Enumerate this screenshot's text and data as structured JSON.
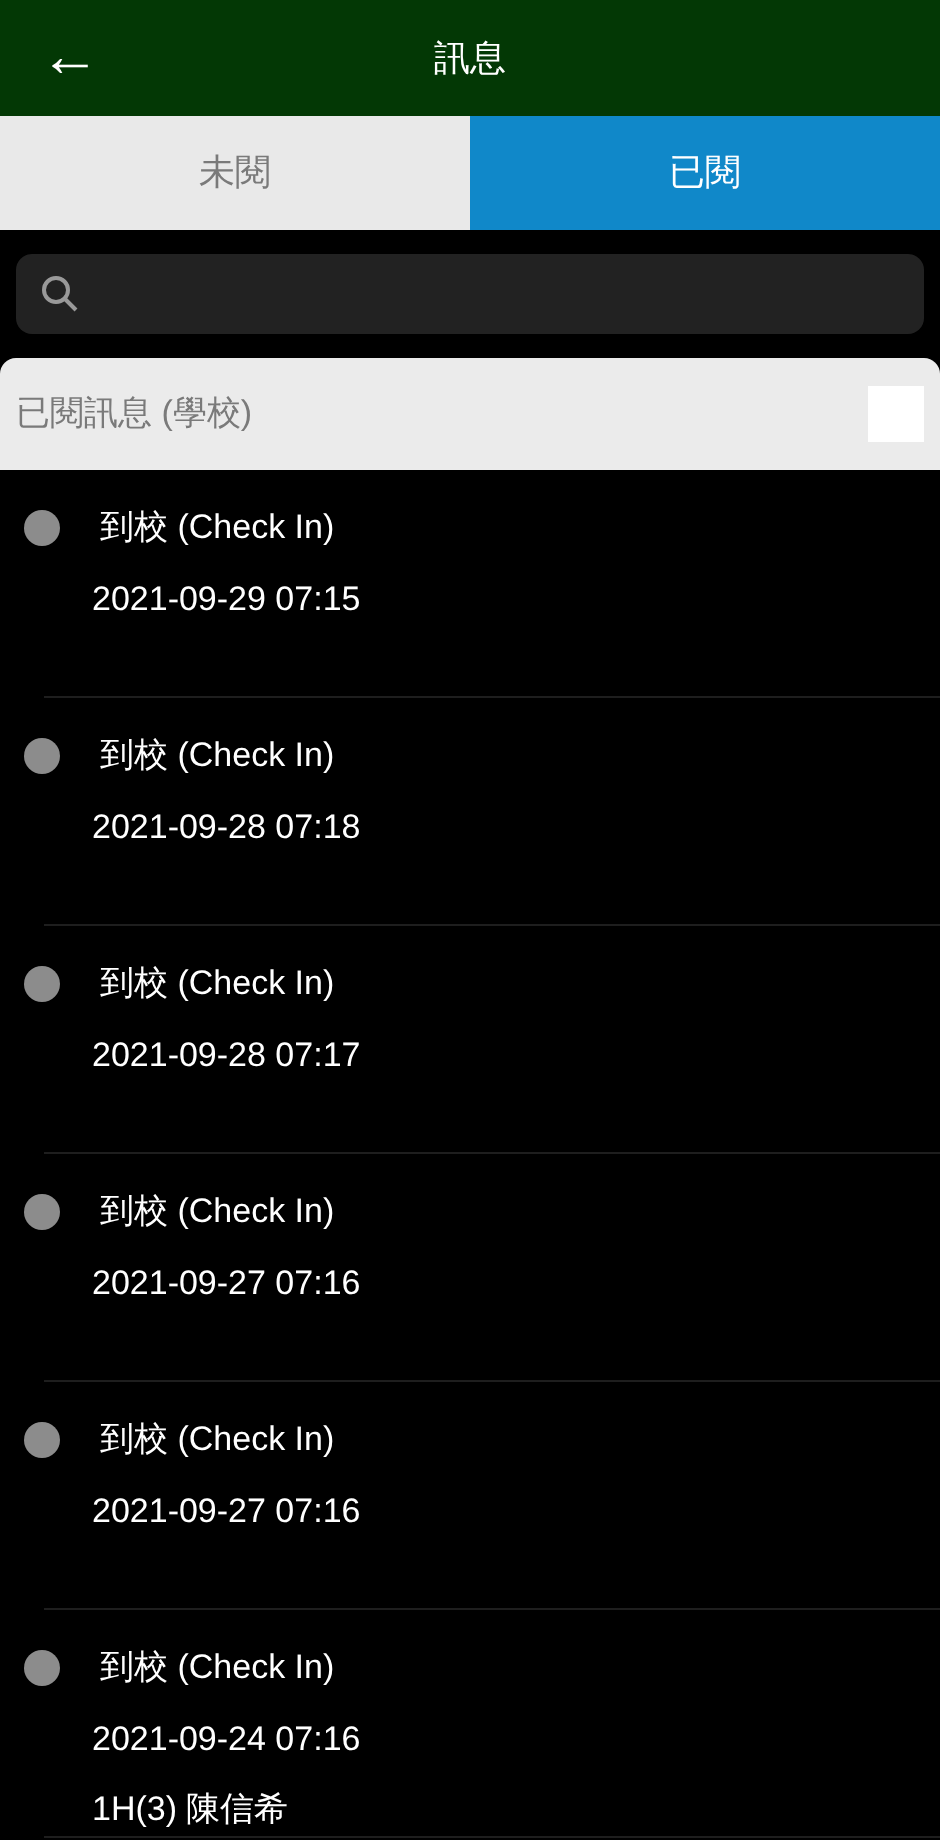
{
  "header": {
    "back_icon": "←",
    "title": "訊息"
  },
  "tabs": [
    {
      "label": "未閱",
      "selected": false
    },
    {
      "label": "已閱",
      "selected": true
    }
  ],
  "section": {
    "title": "已閱訊息 (學校)",
    "checked": false
  },
  "messages": [
    {
      "title": "到校 (Check In)",
      "time": "2021-09-29 07:15"
    },
    {
      "title": "到校 (Check In)",
      "time": "2021-09-28 07:18"
    },
    {
      "title": "到校 (Check In)",
      "time": "2021-09-28 07:17"
    },
    {
      "title": "到校 (Check In)",
      "time": "2021-09-27 07:16"
    },
    {
      "title": "到校 (Check In)",
      "time": "2021-09-27 07:16"
    },
    {
      "title": "到校 (Check In)",
      "time": "2021-09-24 07:16",
      "student": "1H(3) 陳信希"
    }
  ]
}
